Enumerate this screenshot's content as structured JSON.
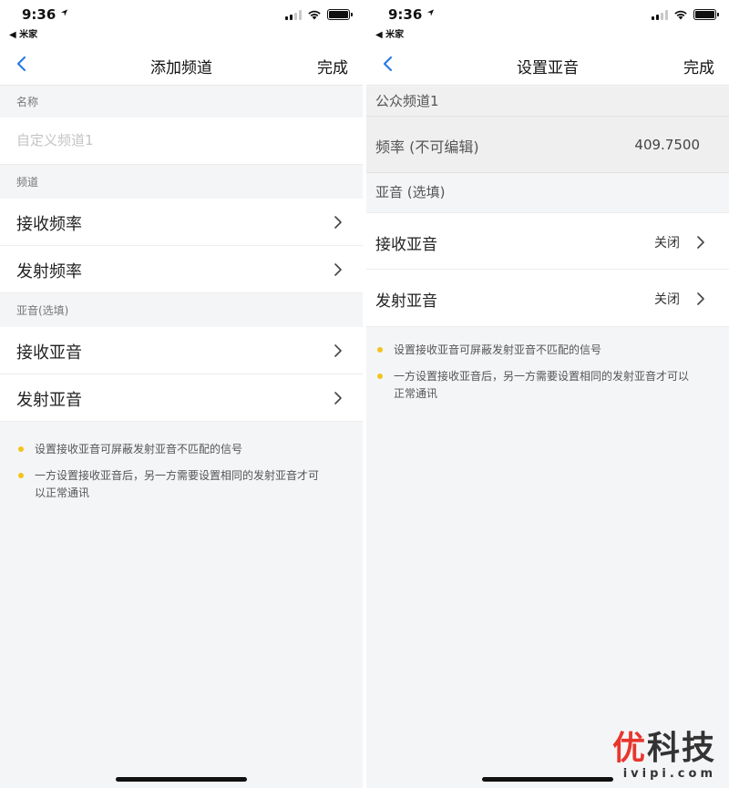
{
  "status": {
    "time": "9:36",
    "back_app": "◀ 米家"
  },
  "colors": {
    "accent": "#2b7be6",
    "note_dot": "#f2c41c",
    "watermark_red": "#e8362d"
  },
  "left": {
    "nav": {
      "title": "添加频道",
      "done": "完成"
    },
    "name_header": "名称",
    "name_placeholder": "自定义频道1",
    "channel_header": "频道",
    "rx_freq": "接收频率",
    "tx_freq": "发射频率",
    "subtone_header": "亚音(选填)",
    "rx_subtone": "接收亚音",
    "tx_subtone": "发射亚音",
    "notes": [
      "设置接收亚音可屏蔽发射亚音不匹配的信号",
      "一方设置接收亚音后，另一方需要设置相同的发射亚音才可以正常通讯"
    ]
  },
  "right": {
    "nav": {
      "title": "设置亚音",
      "done": "完成"
    },
    "channel_name": "公众频道1",
    "freq_label": "频率 (不可编辑)",
    "freq_value": "409.7500",
    "subtone_header": "亚音 (选填)",
    "rx_subtone": "接收亚音",
    "rx_value": "关闭",
    "tx_subtone": "发射亚音",
    "tx_value": "关闭",
    "notes": [
      "设置接收亚音可屏蔽发射亚音不匹配的信号",
      "一方设置接收亚音后，另一方需要设置相同的发射亚音才可以正常通讯"
    ]
  },
  "watermark": {
    "main_red": "优",
    "main_rest": "科技",
    "sub": "ivipi.com"
  }
}
